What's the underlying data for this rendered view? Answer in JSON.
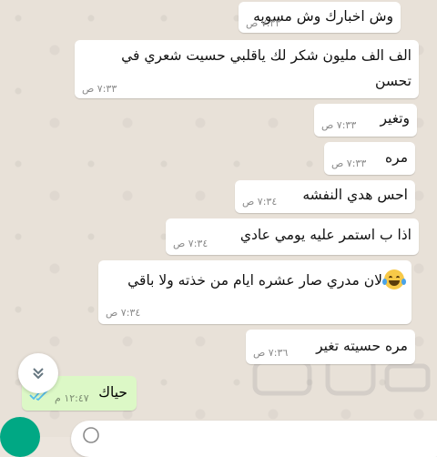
{
  "messages": [
    {
      "text": "وش اخبارك وش مسويه",
      "time": "٧:٣٣ ص"
    },
    {
      "text_line1": "الف الف مليون شكر لك ياقلبي حسيت شعري في",
      "text_line2": "تحسن",
      "time": "٧:٣٣ ص"
    },
    {
      "text": "وتغير",
      "time": "٧:٣٣ ص"
    },
    {
      "text": "مره",
      "time": "٧:٣٣ ص"
    },
    {
      "text": "احس هدي النفشه",
      "time": "٧:٣٤ ص"
    },
    {
      "text": "اذا ب استمر عليه يومي عادي",
      "time": "٧:٣٤ ص"
    },
    {
      "text": "لان مدري صار عشره ايام من خذته ولا باقي",
      "emoji": "face-with-tears-of-joy-icon",
      "time": "٧:٣٤ ص"
    },
    {
      "text": "مره حسيته تغير",
      "time": "٧:٣٦ ص"
    }
  ],
  "outgoing": {
    "text": "حياك",
    "time": "١٢:٤٧ م",
    "status": "read"
  },
  "colors": {
    "incoming_bubble": "#ffffff",
    "outgoing_bubble": "#dcf8c6",
    "read_ticks": "#53bdeb",
    "accent": "#00a884"
  },
  "icons": {
    "scroll_down": "double-chevron-down-icon",
    "read_status": "double-check-icon"
  }
}
